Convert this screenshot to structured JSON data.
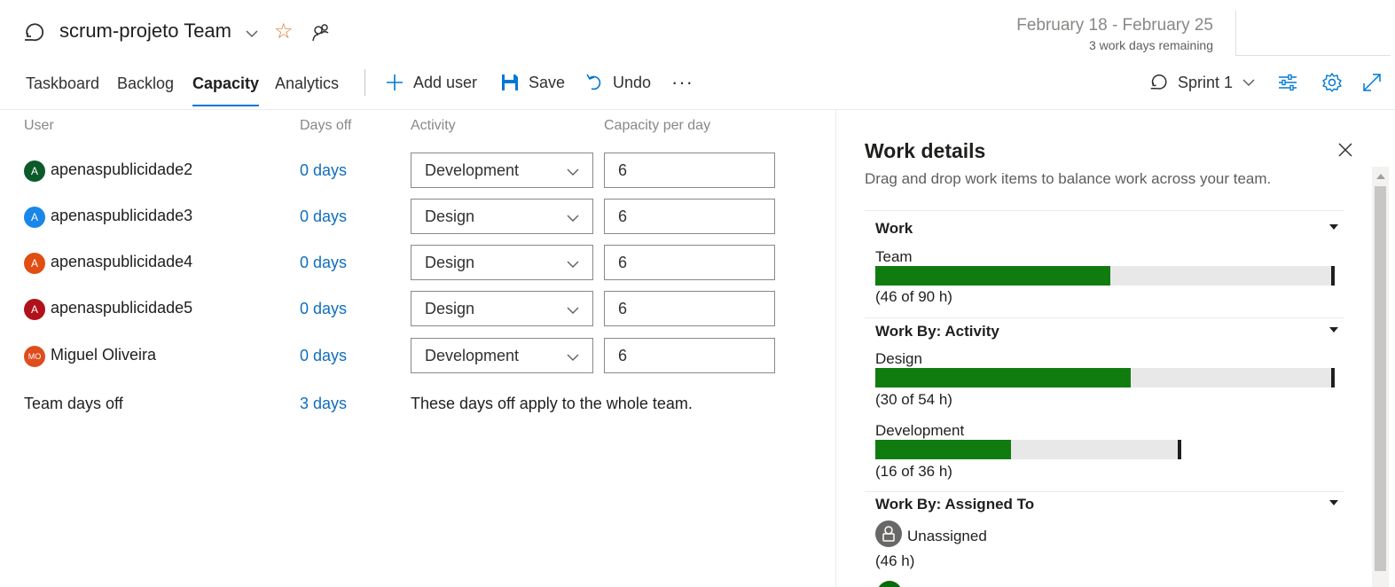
{
  "header": {
    "team_name": "scrum-projeto Team",
    "date_range": "February 18 - February 25",
    "days_remaining": "3 work days remaining"
  },
  "tabs": [
    {
      "label": "Taskboard"
    },
    {
      "label": "Backlog"
    },
    {
      "label": "Capacity",
      "active": true
    },
    {
      "label": "Analytics"
    }
  ],
  "toolbar": {
    "add_user": "Add user",
    "save": "Save",
    "undo": "Undo",
    "more": "···",
    "sprint": "Sprint 1"
  },
  "grid": {
    "headers": {
      "user": "User",
      "days_off": "Days off",
      "activity": "Activity",
      "capacity": "Capacity per day"
    },
    "rows": [
      {
        "initials": "A",
        "avatar_color": "#0b5a2a",
        "user": "apenaspublicidade2",
        "days_off": "0 days",
        "activity": "Development",
        "capacity": "6"
      },
      {
        "initials": "A",
        "avatar_color": "#1a86e8",
        "user": "apenaspublicidade3",
        "days_off": "0 days",
        "activity": "Design",
        "capacity": "6"
      },
      {
        "initials": "A",
        "avatar_color": "#e04e14",
        "user": "apenaspublicidade4",
        "days_off": "0 days",
        "activity": "Design",
        "capacity": "6"
      },
      {
        "initials": "A",
        "avatar_color": "#b1121a",
        "user": "apenaspublicidade5",
        "days_off": "0 days",
        "activity": "Design",
        "capacity": "6"
      },
      {
        "initials": "MO",
        "avatar_color": "#de4d1e",
        "user": "Miguel Oliveira",
        "days_off": "0 days",
        "activity": "Development",
        "capacity": "6"
      }
    ],
    "team_days_off": {
      "label": "Team days off",
      "value": "3 days",
      "note": "These days off apply to the whole team."
    }
  },
  "work_details": {
    "title": "Work details",
    "subtitle": "Drag and drop work items to balance work across your team.",
    "sections": {
      "work": {
        "title": "Work",
        "bars": [
          {
            "label": "Team",
            "value": "(46 of 90 h)",
            "fill": 0.511,
            "marker": 1.0
          }
        ]
      },
      "activity": {
        "title": "Work By: Activity",
        "bars": [
          {
            "label": "Design",
            "value": "(30 of 54 h)",
            "fill": 0.556,
            "marker": 1.0
          },
          {
            "label": "Development",
            "value": "(16 of 36 h)",
            "fill": 0.444,
            "marker": 1.0
          }
        ]
      },
      "assigned": {
        "title": "Work By: Assigned To",
        "items": [
          {
            "label": "Unassigned",
            "value": "(46 h)"
          }
        ]
      }
    }
  },
  "colors": {
    "accent": "#0078d4",
    "bar_fill": "#107c10",
    "bar_track": "#e8e8e8",
    "link": "#106ebe",
    "star": "#d9782c"
  }
}
